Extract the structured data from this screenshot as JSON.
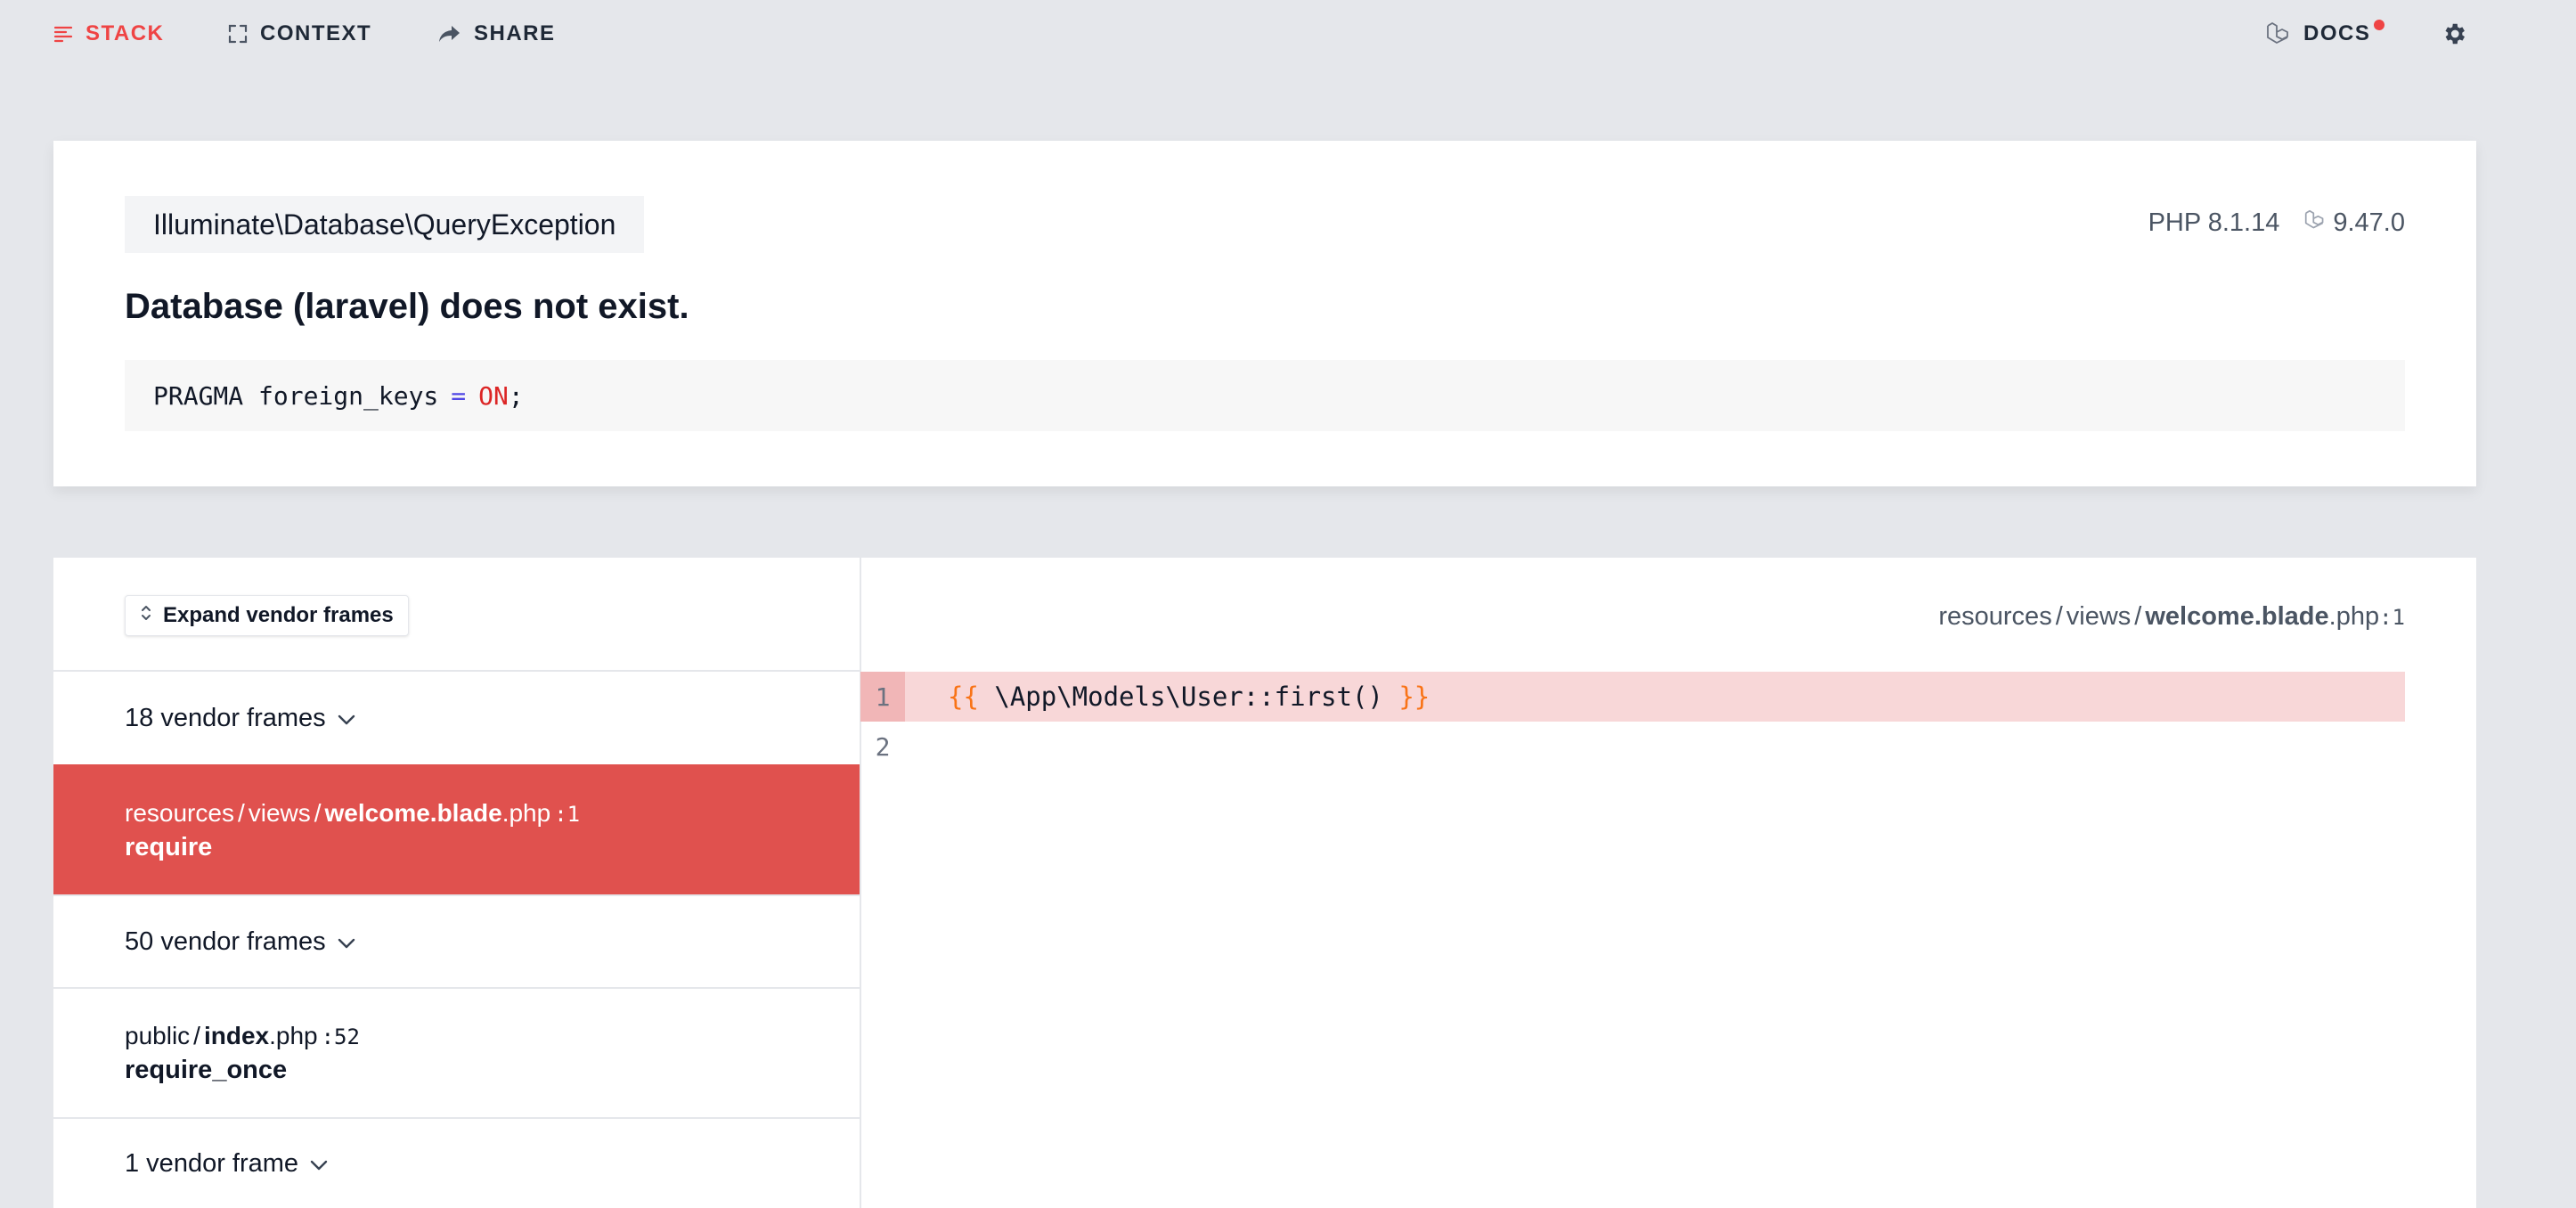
{
  "nav": {
    "stack": "STACK",
    "context": "CONTEXT",
    "share": "SHARE",
    "docs": "DOCS"
  },
  "exception": {
    "class": "Illuminate\\Database\\QueryException",
    "php_version": "PHP 8.1.14",
    "laravel_version": "9.47.0",
    "message": "Database (laravel) does not exist.",
    "sql": {
      "left": "PRAGMA foreign_keys",
      "operator": "=",
      "value": "ON",
      "end": ";"
    }
  },
  "frames": {
    "expand_button": "Expand vendor frames",
    "vendor_group_1": "18 vendor frames",
    "active_frame": {
      "dir1": "resources",
      "dir2": "views",
      "file_bold": "welcome.blade",
      "file_ext": ".php",
      "line": "1",
      "function": "require"
    },
    "vendor_group_2": "50 vendor frames",
    "frame_2": {
      "dir1": "public",
      "file_bold": "index",
      "file_ext": ".php",
      "line": "52",
      "function": "require_once"
    },
    "vendor_group_3": "1 vendor frame"
  },
  "code": {
    "file": {
      "dir1": "resources",
      "dir2": "views",
      "file_bold": "welcome.blade",
      "file_ext": ".php",
      "line": "1"
    },
    "lines": [
      {
        "no": "1",
        "open": "{{",
        "body": " \\App\\Models\\User::first() ",
        "close": "}}"
      },
      {
        "no": "2"
      }
    ]
  },
  "colors": {
    "background": "#e5e7eb",
    "accent_red": "#ef4444",
    "active_frame": "#e0514e",
    "highlight_line": "#f8d7d8",
    "blade_echo": "#f97316"
  }
}
